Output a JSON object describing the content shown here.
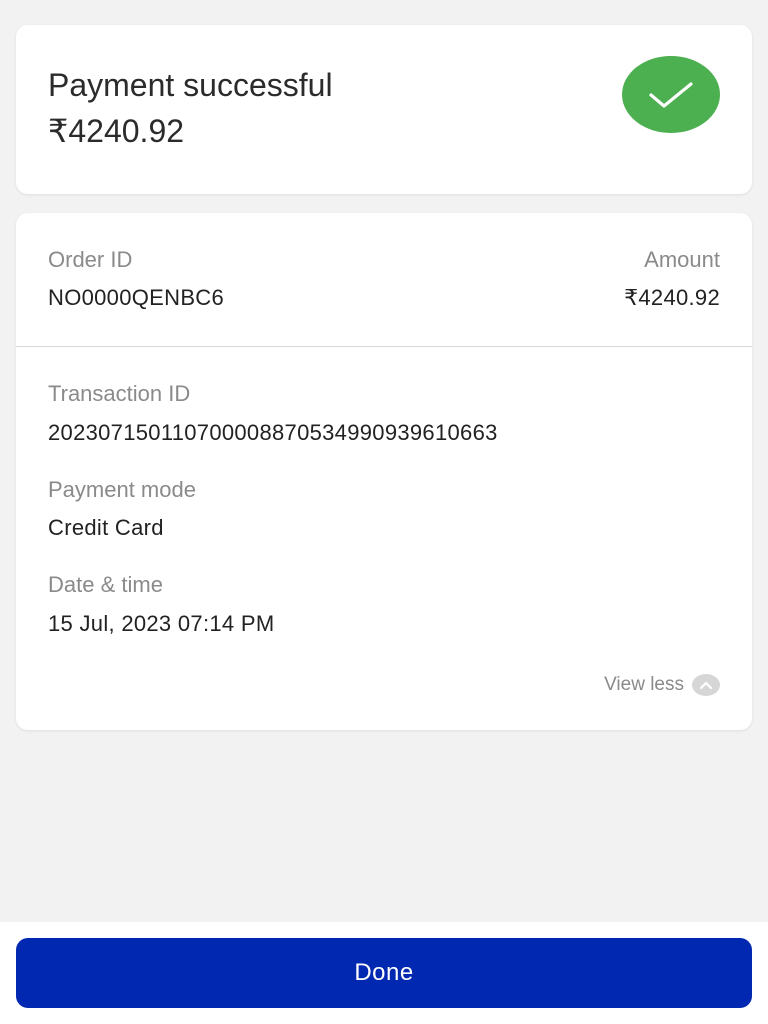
{
  "status": {
    "title": "Payment successful",
    "amount": "₹4240.92",
    "icon": "check-icon",
    "badge_color": "#4caf50"
  },
  "details": {
    "order_id": {
      "label": "Order ID",
      "value": "NO0000QENBC6"
    },
    "amount": {
      "label": "Amount",
      "value": "₹4240.92"
    },
    "transaction_id": {
      "label": "Transaction ID",
      "value": "202307150110700008870534990939610663"
    },
    "payment_mode": {
      "label": "Payment mode",
      "value": "Credit Card"
    },
    "date_time": {
      "label": "Date & time",
      "value": "15 Jul, 2023 07:14 PM"
    },
    "view_less": {
      "label": "View less",
      "icon": "chevron-up-icon",
      "icon_bg": "#d6d6d6"
    }
  },
  "footer": {
    "done_label": "Done",
    "button_color": "#0028b0"
  }
}
